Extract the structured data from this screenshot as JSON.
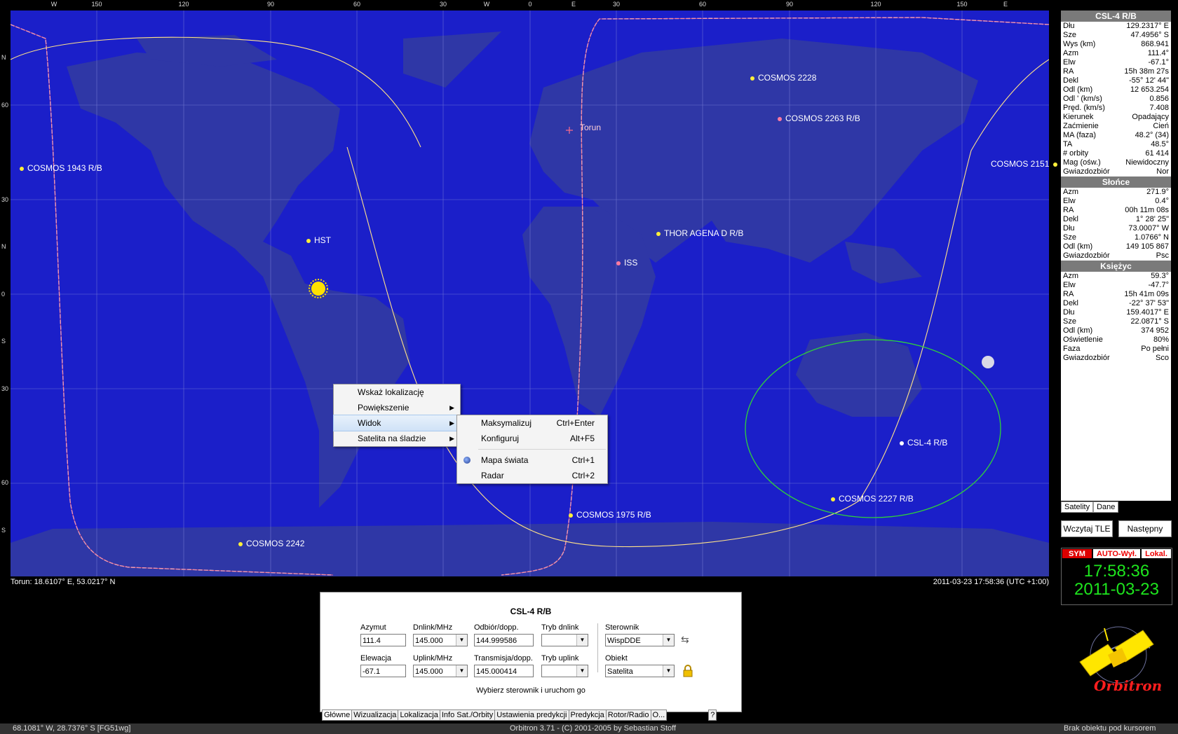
{
  "scale_top": [
    "W",
    "150",
    "120",
    "90",
    "60",
    "30",
    "W",
    "0",
    "E",
    "30",
    "60",
    "90",
    "120",
    "150",
    "E"
  ],
  "scale_left": [
    "N",
    "60",
    "30",
    "N",
    "0",
    "S",
    "30",
    "60",
    "S"
  ],
  "map": {
    "satellites": [
      {
        "name": "COSMOS 1943 R/B",
        "dot": "yellow"
      },
      {
        "name": "COSMOS 2228",
        "dot": "yellow"
      },
      {
        "name": "COSMOS 2263 R/B",
        "dot": "red"
      },
      {
        "name": "COSMOS 2151",
        "dot": "yellow"
      },
      {
        "name": "HST",
        "dot": "yellow"
      },
      {
        "name": "THOR AGENA D R/B",
        "dot": "yellow"
      },
      {
        "name": "ISS",
        "dot": "red"
      },
      {
        "name": "CSL-4 R/B",
        "dot": "white"
      },
      {
        "name": "COSMOS 2227 R/B",
        "dot": "yellow"
      },
      {
        "name": "COSMOS 1975 R/B",
        "dot": "yellow"
      },
      {
        "name": "COSMOS 2242",
        "dot": "yellow"
      }
    ],
    "location_label": "Torun",
    "status_left": "Torun: 18.6107° E, 53.0217° N",
    "status_right": "2011-03-23 17:58:36 (UTC +1:00)"
  },
  "context_menu": {
    "items": [
      {
        "label": "Wskaż lokalizację",
        "submenu": false
      },
      {
        "label": "Powiększenie",
        "submenu": true
      },
      {
        "label": "Widok",
        "submenu": true
      },
      {
        "label": "Satelita na śladzie",
        "submenu": true
      }
    ],
    "submenu": [
      {
        "label": "Maksymalizuj",
        "shortcut": "Ctrl+Enter"
      },
      {
        "label": "Konfiguruj",
        "shortcut": "Alt+F5"
      },
      {
        "label": "Mapa świata",
        "shortcut": "Ctrl+1",
        "checked": true
      },
      {
        "label": "Radar",
        "shortcut": "Ctrl+2"
      }
    ]
  },
  "info_panel": {
    "sat_title": "CSL-4 R/B",
    "sat_rows": [
      [
        "Dłu",
        "129.2317° E"
      ],
      [
        "Sze",
        "47.4956° S"
      ],
      [
        "Wys (km)",
        "868.941"
      ],
      [
        "Azm",
        "111.4°"
      ],
      [
        "Elw",
        "-67.1°"
      ],
      [
        "RA",
        "15h 38m 27s"
      ],
      [
        "Dekl",
        "-55° 12' 44\""
      ],
      [
        "Odl (km)",
        "12 653.254"
      ],
      [
        "Odl ' (km/s)",
        "0.856"
      ],
      [
        "Pręd. (km/s)",
        "7.408"
      ],
      [
        "Kierunek",
        "Opadający"
      ],
      [
        "Zaćmienie",
        "Cień"
      ],
      [
        "MA (faza)",
        "48.2° (34)"
      ],
      [
        "TA",
        "48.5°"
      ],
      [
        "# orbity",
        "61 414"
      ],
      [
        "Mag (ośw.)",
        "Niewidoczny"
      ],
      [
        "Gwiazdozbiór",
        "Nor"
      ]
    ],
    "sun_title": "Słońce",
    "sun_rows": [
      [
        "Azm",
        "271.9°"
      ],
      [
        "Elw",
        "0.4°"
      ],
      [
        "RA",
        "00h 11m 08s"
      ],
      [
        "Dekl",
        "1° 28' 25\""
      ],
      [
        "Dłu",
        "73.0007° W"
      ],
      [
        "Sze",
        "1.0766° N"
      ],
      [
        "Odl (km)",
        "149 105 867"
      ],
      [
        "Gwiazdozbiór",
        "Psc"
      ]
    ],
    "moon_title": "Księżyc",
    "moon_rows": [
      [
        "Azm",
        "59.3°"
      ],
      [
        "Elw",
        "-47.7°"
      ],
      [
        "RA",
        "15h 41m 09s"
      ],
      [
        "Dekl",
        "-22° 37' 53\""
      ],
      [
        "Dłu",
        "159.4017° E"
      ],
      [
        "Sze",
        "22.0871° S"
      ],
      [
        "Odl (km)",
        "374 952"
      ],
      [
        "Oświetlenie",
        "80%"
      ],
      [
        "Faza",
        "Po pełni"
      ],
      [
        "Gwiazdozbiór",
        "Sco"
      ]
    ],
    "tabs": [
      "Satelity",
      "Dane"
    ]
  },
  "buttons": {
    "load_tle": "Wczytaj TLE",
    "next": "Następny"
  },
  "clock": {
    "tabs": [
      "SYM",
      "AUTO-Wył.",
      "Lokal."
    ],
    "time": "17:58:36",
    "date": "2011-03-23"
  },
  "logo_text": "Orbitron",
  "bottom": {
    "title": "CSL-4 R/B",
    "azymut_label": "Azymut",
    "azymut": "111.4",
    "dnlink_label": "Dnlink/MHz",
    "dnlink": "145.000",
    "odbior_label": "Odbiór/dopp.",
    "odbior": "144.999586",
    "tryb_dn_label": "Tryb dnlink",
    "tryb_dn": "",
    "sterownik_label": "Sterownik",
    "sterownik": "WispDDE",
    "elewacja_label": "Elewacja",
    "elewacja": "-67.1",
    "uplink_label": "Uplink/MHz",
    "uplink": "145.000",
    "transmisja_label": "Transmisja/dopp.",
    "transmisja": "145.000414",
    "tryb_up_label": "Tryb uplink",
    "tryb_up": "",
    "obiekt_label": "Obiekt",
    "obiekt": "Satelita",
    "hint": "Wybierz sterownik i uruchom go"
  },
  "bottom_tabs": [
    "Główne",
    "Wizualizacja",
    "Lokalizacja",
    "Info Sat./Orbity",
    "Ustawienia predykcji",
    "Predykcja",
    "Rotor/Radio",
    "O...",
    "?"
  ],
  "statusbar": {
    "left": "68.1081° W, 28.7376° S [FG51wg]",
    "center": "Orbitron 3.71 - (C) 2001-2005 by Sebastian Stoff",
    "right": "Brak obiektu pod kursorem"
  },
  "colors": {
    "map_ocean": "#1b1fc9",
    "land": "#2f37a6",
    "clock_green": "#1ee51e",
    "highlight": "#d00000"
  }
}
